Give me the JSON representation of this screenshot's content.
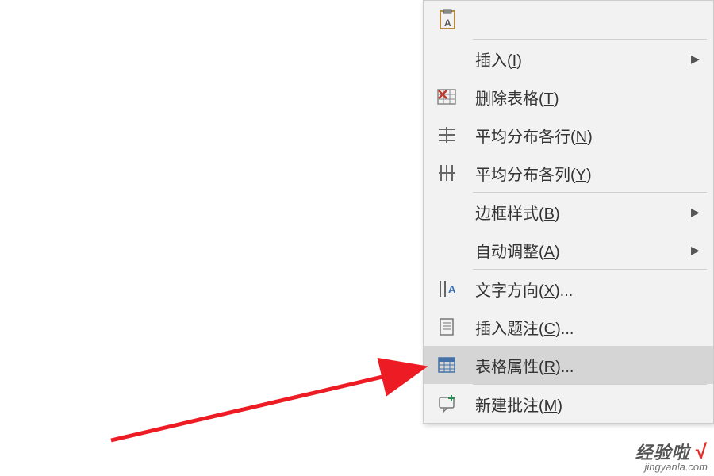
{
  "menu": {
    "paste_icon": "paste",
    "items": [
      {
        "label": "插入(",
        "accel": "I",
        "tail": ")",
        "icon": "",
        "submenu": true
      },
      {
        "label": "删除表格(",
        "accel": "T",
        "tail": ")",
        "icon": "delete-table",
        "submenu": false
      },
      {
        "label": "平均分布各行(",
        "accel": "N",
        "tail": ")",
        "icon": "dist-rows",
        "submenu": false
      },
      {
        "label": "平均分布各列(",
        "accel": "Y",
        "tail": ")",
        "icon": "dist-cols",
        "submenu": false
      },
      {
        "label": "边框样式(",
        "accel": "B",
        "tail": ")",
        "icon": "",
        "submenu": true
      },
      {
        "label": "自动调整(",
        "accel": "A",
        "tail": ")",
        "icon": "",
        "submenu": true
      },
      {
        "label": "文字方向(",
        "accel": "X",
        "tail": ")...",
        "icon": "text-dir",
        "submenu": false
      },
      {
        "label": "插入题注(",
        "accel": "C",
        "tail": ")...",
        "icon": "caption",
        "submenu": false
      },
      {
        "label": "表格属性(",
        "accel": "R",
        "tail": ")...",
        "icon": "table-props",
        "submenu": false,
        "highlighted": true
      },
      {
        "label": "新建批注(",
        "accel": "M",
        "tail": ")",
        "icon": "new-comment",
        "submenu": false
      }
    ]
  },
  "watermark": {
    "line1": "经验啦",
    "check": "√",
    "line2": "jingyanla.com"
  }
}
